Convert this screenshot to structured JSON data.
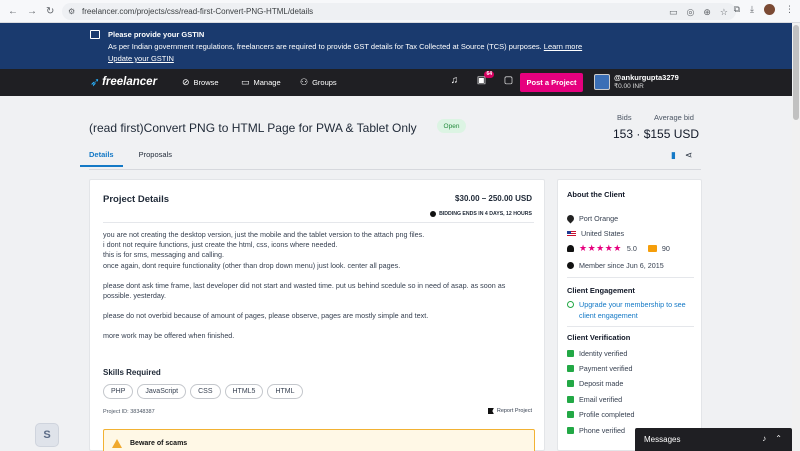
{
  "browser": {
    "url": "freelancer.com/projects/css/read-first-Convert-PNG-HTML/details"
  },
  "banner": {
    "title": "Please provide your GSTIN",
    "text": "As per Indian government regulations, freelancers are required to provide GST details for Tax Collected at Source (TCS) purposes.",
    "learn_more": "Learn more",
    "update_link": "Update your GSTIN"
  },
  "header": {
    "logo": "freelancer",
    "nav": [
      "Browse",
      "Manage",
      "Groups"
    ],
    "notification_count": "64",
    "post_button": "Post a Project",
    "username": "@ankurgupta3279",
    "balance": "₹0.00 INR"
  },
  "project": {
    "title": "(read first)Convert PNG to HTML Page for PWA & Tablet Only",
    "status": "Open",
    "bids_label": "Bids",
    "avg_label": "Average bid",
    "bids_value": "153",
    "avg_value": "$155 USD",
    "tabs": [
      "Details",
      "Proposals"
    ]
  },
  "details": {
    "heading": "Project Details",
    "budget": "$30.00 – 250.00 USD",
    "ends": "BIDDING ENDS IN 4 DAYS, 12 HOURS",
    "paragraphs": [
      "you are not creating the desktop version, just the mobile and the tablet version to the attach png files.",
      "i dont not require functions, just create the html, css, icons where needed.",
      "this is for sms, messaging and calling.",
      "once again, dont require functionality (other than drop down menu) just look. center all pages."
    ],
    "paragraph2": "please dont ask time frame, last developer did not start and wasted time. put us behind scedule so in need of asap. as soon as possible. yesterday.",
    "paragraph3": "please do not overbid because of amount of pages, please observe, pages are mostly simple and text.",
    "paragraph4": "more work may be offered when finished.",
    "skills_heading": "Skills Required",
    "skills": [
      "PHP",
      "JavaScript",
      "CSS",
      "HTML5",
      "HTML"
    ],
    "project_id": "Project ID: 38348387",
    "report": "Report Project",
    "scam_warning": "Beware of scams"
  },
  "client": {
    "heading": "About the Client",
    "city": "Port Orange",
    "country": "United States",
    "rating": "5.0",
    "reviews": "90",
    "member_since": "Member since Jun 6, 2015",
    "engagement_heading": "Client Engagement",
    "engagement_link": "Upgrade your membership to see client engagement",
    "verification_heading": "Client Verification",
    "verifications": [
      "Identity verified",
      "Payment verified",
      "Deposit made",
      "Email verified",
      "Profile completed",
      "Phone verified"
    ]
  },
  "messages": {
    "label": "Messages"
  },
  "colors": {
    "banner_bg": "#1a3a6e",
    "header_bg": "#1f1f23",
    "accent_pink": "#e6007e",
    "link_blue": "#1479c6"
  }
}
